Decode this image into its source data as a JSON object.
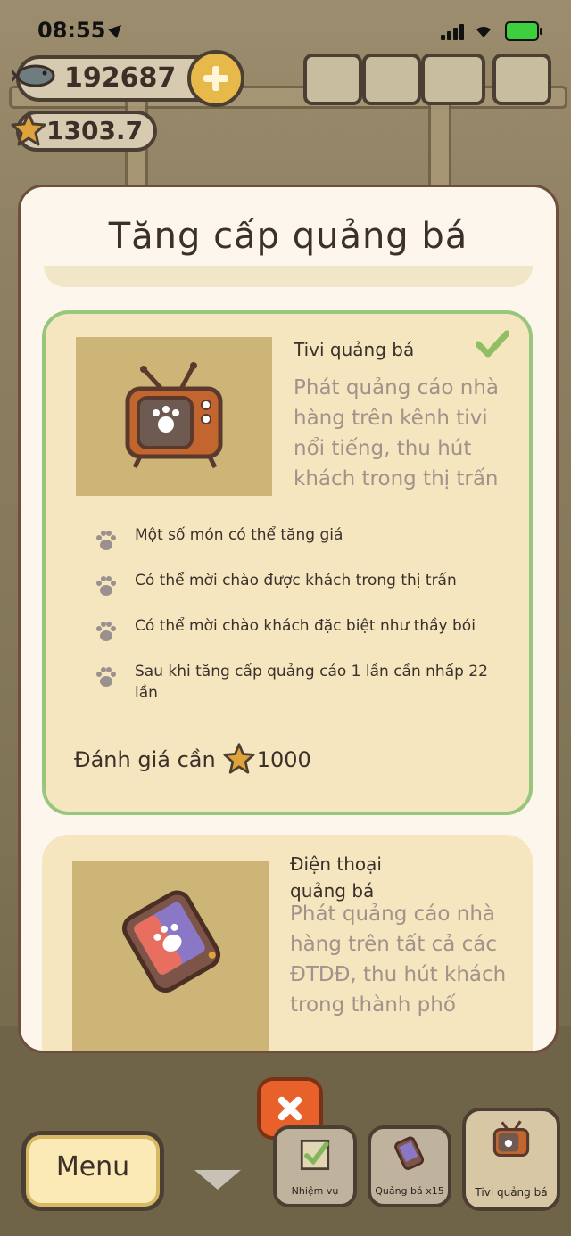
{
  "status_bar": {
    "time": "08:55"
  },
  "hud": {
    "coins": "192687",
    "stars": "1303.7"
  },
  "modal": {
    "title": "Tăng cấp quảng bá",
    "cards": [
      {
        "name": "Tivi quảng bá",
        "description": "Phát quảng cáo nhà hàng trên kênh tivi nổi tiếng, thu hút khách trong thị trấn",
        "selected": true,
        "perks": [
          "Một số món có thể tăng giá",
          "Có thể mời chào được khách trong thị trấn",
          "Có thể mời chào khách đặc biệt như thầy bói",
          "Sau khi tăng cấp quảng cáo 1 lần cần nhấp  22 lần"
        ],
        "requirement_label": "Đánh giá cần",
        "requirement_value": "1000"
      },
      {
        "name": "Điện thoại quảng bá",
        "description": "Phát quảng cáo nhà hàng trên tất cả các ĐTDĐ, thu hút khách trong thành phố"
      }
    ]
  },
  "bottom_bar": {
    "menu_label": "Menu",
    "tabs": [
      {
        "label": "Nhiệm vụ"
      },
      {
        "label": "Quảng bá x15"
      },
      {
        "label": "Tivi quảng bá"
      }
    ]
  },
  "colors": {
    "accent_green": "#98c67c",
    "close_orange": "#e8612a",
    "card_bg": "#f5e6c0"
  }
}
